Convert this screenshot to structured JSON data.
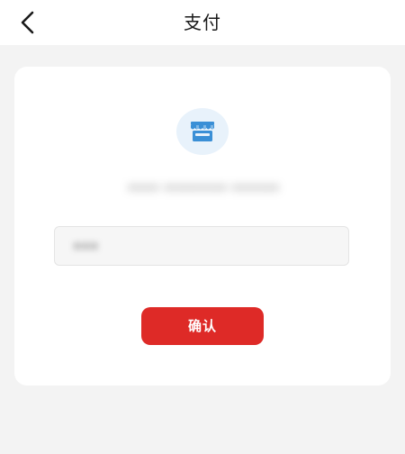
{
  "header": {
    "title": "支付",
    "back_icon": "chevron-left-icon"
  },
  "merchant": {
    "icon": "store-icon",
    "icon_color": "#3a8fd6",
    "name": "•••• •••••••• ••••••"
  },
  "amount_input": {
    "value": "•••"
  },
  "confirm": {
    "label": "确认",
    "color": "#de2a27"
  }
}
